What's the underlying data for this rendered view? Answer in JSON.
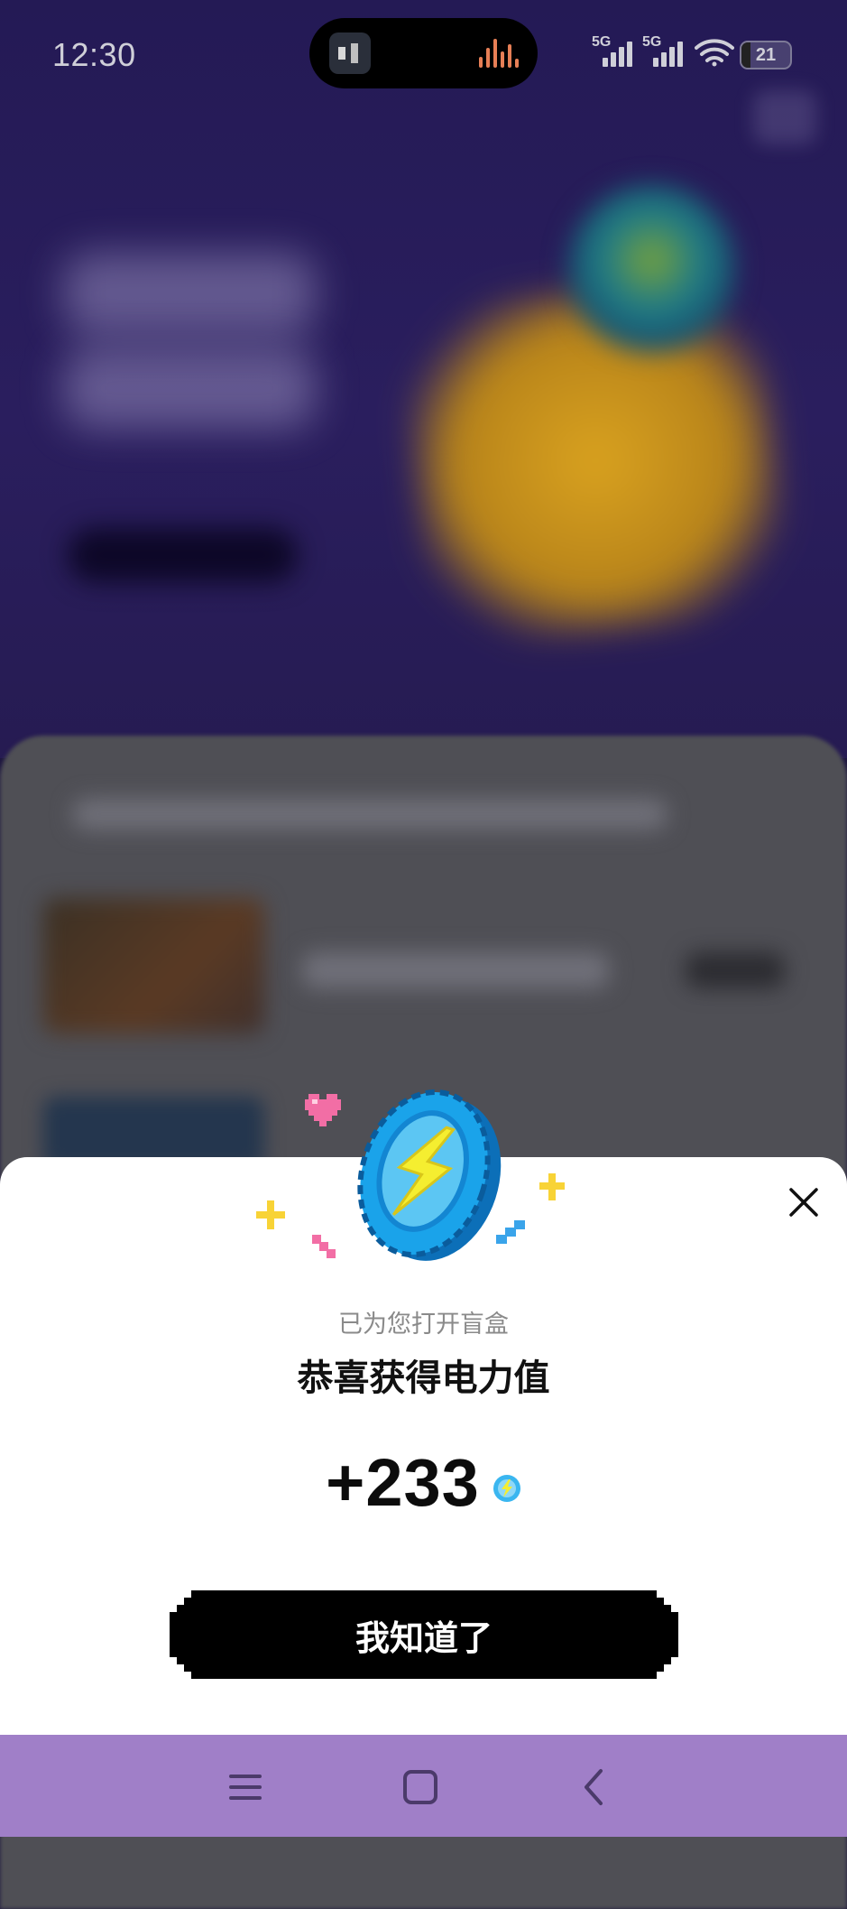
{
  "status_bar": {
    "time": "12:30",
    "signal1_label": "5G",
    "signal2_label": "5G",
    "battery": "21"
  },
  "popup": {
    "subtitle": "已为您打开盲盒",
    "title": "恭喜获得电力值",
    "amount": "+233",
    "confirm_label": "我知道了",
    "icon_names": [
      "power-coin-icon",
      "heart-icon",
      "sparkle-icon",
      "close-icon",
      "lightning-coin-icon"
    ]
  },
  "navigation": {
    "icons": [
      "menu-icon",
      "home-icon",
      "back-icon"
    ]
  },
  "colors": {
    "sheet_bg": "#ffffff",
    "button_bg": "#000000",
    "nav_bar_bg": "#a07fc8",
    "coin_blue": "#1aa3ea",
    "bolt_yellow": "#f5ee30",
    "heart_pink": "#f26ea5"
  }
}
